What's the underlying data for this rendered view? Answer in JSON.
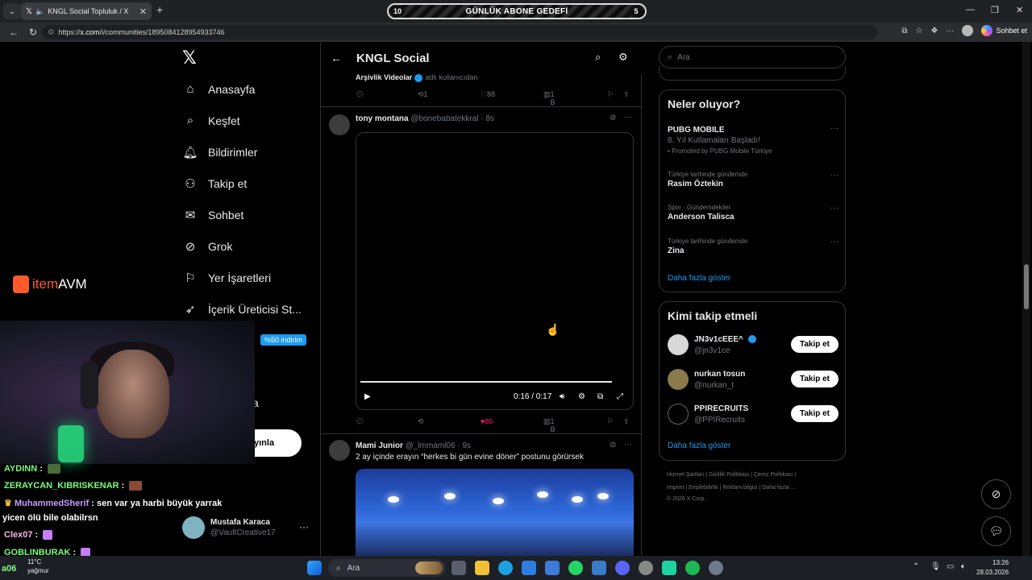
{
  "browser": {
    "tab_title": "KNGL Social Topluluk / X",
    "new_tab_label": "+",
    "url_prefix": "https://",
    "url_domain": "x.com",
    "url_path": "/i/communities/1895084128954933746",
    "copilot_label": "Sohbet et"
  },
  "overlay": {
    "goal_left": "10",
    "goal_text": "GÜNLÜK ABONE GEDEFİ",
    "goal_right": "5",
    "sponsor_brand_item": "item",
    "sponsor_brand_rest": "AVM"
  },
  "sidebar": {
    "items": [
      {
        "label": "Anasayfa",
        "icon": "home-icon"
      },
      {
        "label": "Keşfet",
        "icon": "search-icon"
      },
      {
        "label": "Bildirimler",
        "icon": "bell-icon"
      },
      {
        "label": "Takip et",
        "icon": "add-user-icon"
      },
      {
        "label": "Sohbet",
        "icon": "mail-icon"
      },
      {
        "label": "Grok",
        "icon": "grok-icon"
      },
      {
        "label": "Yer İşaretleri",
        "icon": "bookmark-icon"
      },
      {
        "label": "İçerik Üreticisi St...",
        "icon": "rocket-icon"
      }
    ],
    "discount_badge": "%50 indirim",
    "partial_label": "a",
    "post_button": "yınla",
    "account_name": "Mustafa Karaca",
    "account_handle": "@VaultCreative17"
  },
  "chat": {
    "lines": [
      {
        "user": "AYDINN",
        "text": "",
        "color": "#7CFC7C"
      },
      {
        "user": "ZERAYCAN_KIBRISKENAR",
        "text": "",
        "color": "#7CFC7C"
      },
      {
        "user": "MuhammedSherif",
        "text": "sen var ya harbi büyük yarrak",
        "color": "#c79cff"
      },
      {
        "user": "",
        "text": "yicen ölü bile olabilrsn",
        "color": "#ffffff"
      },
      {
        "user": "Clex07",
        "text": "",
        "color": "#ffb3e6"
      },
      {
        "user": "GOBLINBURAK",
        "text": "",
        "color": "#7CFC7C"
      }
    ]
  },
  "feed": {
    "title": "KNGL Social",
    "source_name": "Arşivlik Videolar",
    "source_suffix": "adlı kullanıcıdan",
    "post1_actions": {
      "reposts": "1",
      "likes": "88",
      "views": "1 B"
    },
    "post2": {
      "name": "tony montana",
      "handle": "@bonebabatekkral",
      "time": "· 8s",
      "video_time": "0:16 / 0:17",
      "progress": 0.94,
      "likes": "86",
      "views": "1 B"
    },
    "post3": {
      "name": "Mami Junior",
      "handle": "@_lmmaml06",
      "time": "· 9s",
      "text": "2 ay içinde erayın “herkes bi gün evine döner” postunu görürsek"
    }
  },
  "right": {
    "search_placeholder": "Ara",
    "trends_title": "Neler oluyor?",
    "trends": [
      {
        "context": "",
        "name": "PUBG MOBILE",
        "sub": "8. Yıl Kutlamaları Başladı!",
        "promo": "Promoted by PUBG Mobile Türkiye"
      },
      {
        "context": "Türkiye tarihinde gündemde",
        "name": "Rasim Öztekin",
        "sub": "",
        "promo": ""
      },
      {
        "context": "Spor · Gündemdekiler",
        "name": "Anderson Talisca",
        "sub": "",
        "promo": ""
      },
      {
        "context": "Türkiye tarihinde gündemde",
        "name": "Zina",
        "sub": "",
        "promo": ""
      }
    ],
    "show_more": "Daha fazla göster",
    "who_title": "Kimi takip etmeli",
    "follow_button": "Takip et",
    "suggestions": [
      {
        "name": "JN3v1cEEE^",
        "handle": "@jn3v1ce"
      },
      {
        "name": "nurkan tosun",
        "handle": "@nurkan_t"
      },
      {
        "name": "PPIRECRUITS",
        "handle": "@PPIRecruits"
      }
    ],
    "footer_line1": "Hizmet Şartları  |  Gizlilik Politikası  |  Çerez Politikası  |",
    "footer_line2": "Imprint  |  Erişilebilirlik  |  Reklam bilgisi  |  Daha fazla ...",
    "footer_line3": "© 2026 X Corp."
  },
  "taskbar": {
    "search_label": "Ara",
    "time": "13:26",
    "date": "28.03.2026",
    "temp": "11°C",
    "weather": "yağmur",
    "chat_overlap": "a06"
  }
}
